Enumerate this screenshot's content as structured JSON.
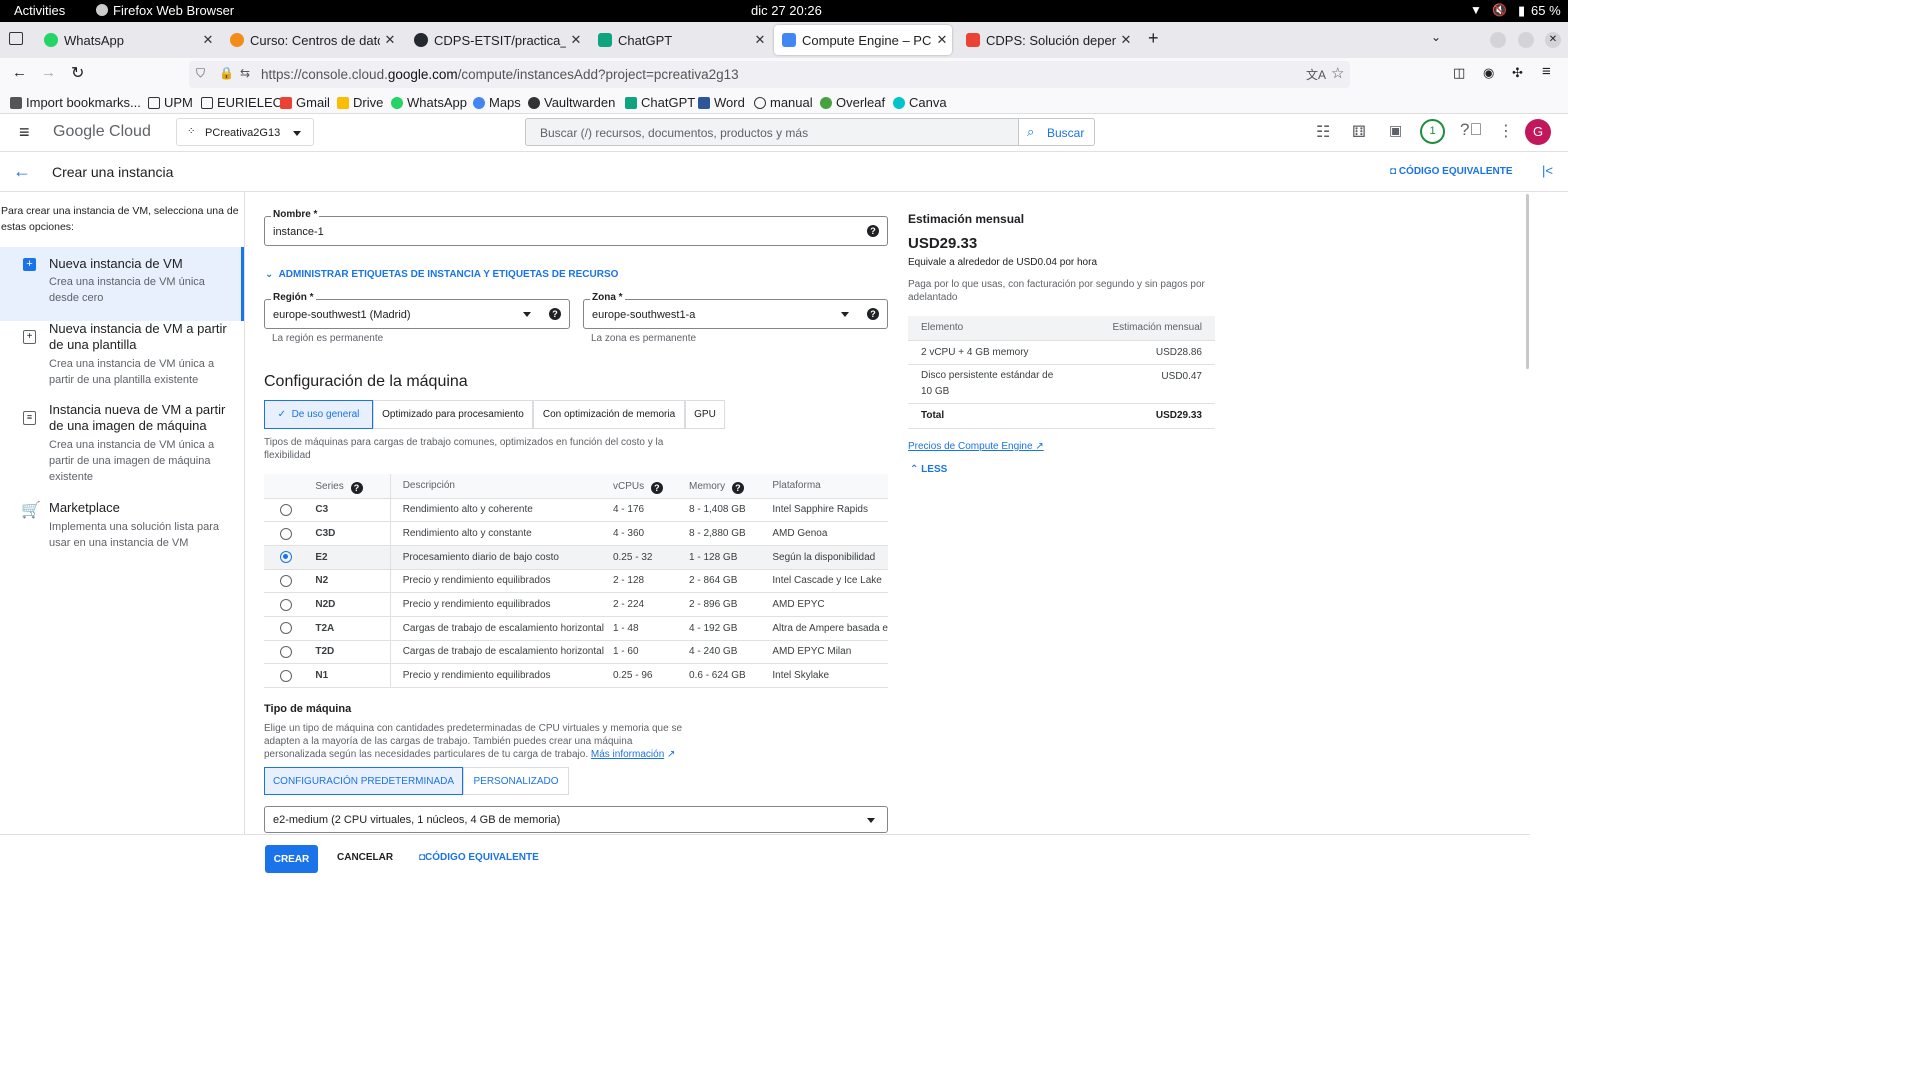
{
  "gnome": {
    "activities": "Activities",
    "app": "Firefox Web Browser",
    "clock": "dic 27  20:26",
    "battery": "65 %"
  },
  "tabs": [
    {
      "title": "WhatsApp",
      "color": "#25d366"
    },
    {
      "title": "Curso: Centros de datos y",
      "color": "#f28c1b"
    },
    {
      "title": "CDPS-ETSIT/practica_crea",
      "color": "#24292f"
    },
    {
      "title": "ChatGPT",
      "color": "#10a37f"
    },
    {
      "title": "Compute Engine – PCrea",
      "color": "#4285f4"
    },
    {
      "title": "CDPS: Solución depender",
      "color": "#ea4335"
    }
  ],
  "url": {
    "prefix": "https://console.cloud.",
    "domain": "google.com",
    "rest": "/compute/instancesAdd?project=pcreativa2g13"
  },
  "bookmarks": [
    "Import bookmarks...",
    "UPM",
    "EURIELEC",
    "Gmail",
    "Drive",
    "WhatsApp",
    "Maps",
    "Vaultwarden",
    "ChatGPT",
    "Word",
    "manual",
    "Overleaf",
    "Canva"
  ],
  "header": {
    "brand_google": "Google",
    "brand_cloud": "Cloud",
    "project": "PCreativa2G13",
    "search_placeholder": "Buscar (/) recursos, documentos, productos y más",
    "search_button": "Buscar",
    "notif_count": "1",
    "avatar": "G"
  },
  "title_row": {
    "title": "Crear una instancia",
    "equiv_code": "CÓDIGO EQUIVALENTE"
  },
  "left": {
    "intro": "Para crear una instancia de VM, selecciona una de estas opciones:",
    "options": [
      {
        "title": "Nueva instancia de VM",
        "desc": "Crea una instancia de VM única desde cero"
      },
      {
        "title": "Nueva instancia de VM a partir de una plantilla",
        "desc": "Crea una instancia de VM única a partir de una plantilla existente"
      },
      {
        "title": "Instancia nueva de VM a partir de una imagen de máquina",
        "desc": "Crea una instancia de VM única a partir de una imagen de máquina existente"
      },
      {
        "title": "Marketplace",
        "desc": "Implementa una solución lista para usar en una instancia de VM"
      }
    ]
  },
  "form": {
    "name_label": "Nombre *",
    "name_value": "instance-1",
    "labels_link": "ADMINISTRAR ETIQUETAS DE INSTANCIA Y ETIQUETAS DE RECURSO",
    "region_label": "Región *",
    "region_value": "europe-southwest1 (Madrid)",
    "region_hint": "La región es permanente",
    "zone_label": "Zona *",
    "zone_value": "europe-southwest1-a",
    "zone_hint": "La zona es permanente",
    "machine_heading": "Configuración de la máquina",
    "families": [
      "De uso general",
      "Optimizado para procesamiento",
      "Con optimización de memoria",
      "GPU"
    ],
    "family_desc": "Tipos de máquinas para cargas de trabajo comunes, optimizados en función del costo y la flexibilidad",
    "series_headers": [
      "Series",
      "Descripción",
      "vCPUs",
      "Memory",
      "Plataforma"
    ],
    "series": [
      {
        "name": "C3",
        "desc": "Rendimiento alto y coherente",
        "vcpus": "4 - 176",
        "mem": "8 - 1,408 GB",
        "plat": "Intel Sapphire Rapids",
        "selected": false
      },
      {
        "name": "C3D",
        "desc": "Rendimiento alto y constante",
        "vcpus": "4 - 360",
        "mem": "8 - 2,880 GB",
        "plat": "AMD Genoa",
        "selected": false
      },
      {
        "name": "E2",
        "desc": "Procesamiento diario de bajo costo",
        "vcpus": "0.25 - 32",
        "mem": "1 - 128 GB",
        "plat": "Según la disponibilidad",
        "selected": true
      },
      {
        "name": "N2",
        "desc": "Precio y rendimiento equilibrados",
        "vcpus": "2 - 128",
        "mem": "2 - 864 GB",
        "plat": "Intel Cascade y Ice Lake",
        "selected": false
      },
      {
        "name": "N2D",
        "desc": "Precio y rendimiento equilibrados",
        "vcpus": "2 - 224",
        "mem": "2 - 896 GB",
        "plat": "AMD EPYC",
        "selected": false
      },
      {
        "name": "T2A",
        "desc": "Cargas de trabajo de escalamiento horizontal",
        "vcpus": "1 - 48",
        "mem": "4 - 192 GB",
        "plat": "Altra de Ampere basada e",
        "selected": false
      },
      {
        "name": "T2D",
        "desc": "Cargas de trabajo de escalamiento horizontal",
        "vcpus": "1 - 60",
        "mem": "4 - 240 GB",
        "plat": "AMD EPYC Milan",
        "selected": false
      },
      {
        "name": "N1",
        "desc": "Precio y rendimiento equilibrados",
        "vcpus": "0.25 - 96",
        "mem": "0.6 - 624 GB",
        "plat": "Intel Skylake",
        "selected": false
      }
    ],
    "machine_type_heading": "Tipo de máquina",
    "machine_type_desc": "Elige un tipo de máquina con cantidades predeterminadas de CPU virtuales y memoria que se adapten a la mayoría de las cargas de trabajo. También puedes crear una máquina personalizada según las necesidades particulares de tu carga de trabajo.",
    "more_info": "Más información",
    "preset_btn": "CONFIGURACIÓN PREDETERMINADA",
    "custom_btn": "PERSONALIZADO",
    "machine_type_value": "e2-medium (2 CPU virtuales, 1 núcleos, 4 GB de memoria)"
  },
  "estimate": {
    "heading": "Estimación mensual",
    "total": "USD29.33",
    "hourly": "Equivale a alrededor de USD0.04 por hora",
    "note": "Paga por lo que usas, con facturación por segundo y sin pagos por adelantado",
    "headers": [
      "Elemento",
      "Estimación mensual"
    ],
    "rows": [
      {
        "item": "2 vCPU + 4 GB memory",
        "cost": "USD28.86"
      },
      {
        "item": "Disco persistente estándar de 10 GB",
        "cost": "USD0.47"
      },
      {
        "item": "Total",
        "cost": "USD29.33"
      }
    ],
    "pricing_link": "Precios de Compute Engine",
    "less": "LESS"
  },
  "bottom": {
    "create": "CREAR",
    "cancel": "CANCELAR",
    "equiv": "CÓDIGO EQUIVALENTE"
  }
}
